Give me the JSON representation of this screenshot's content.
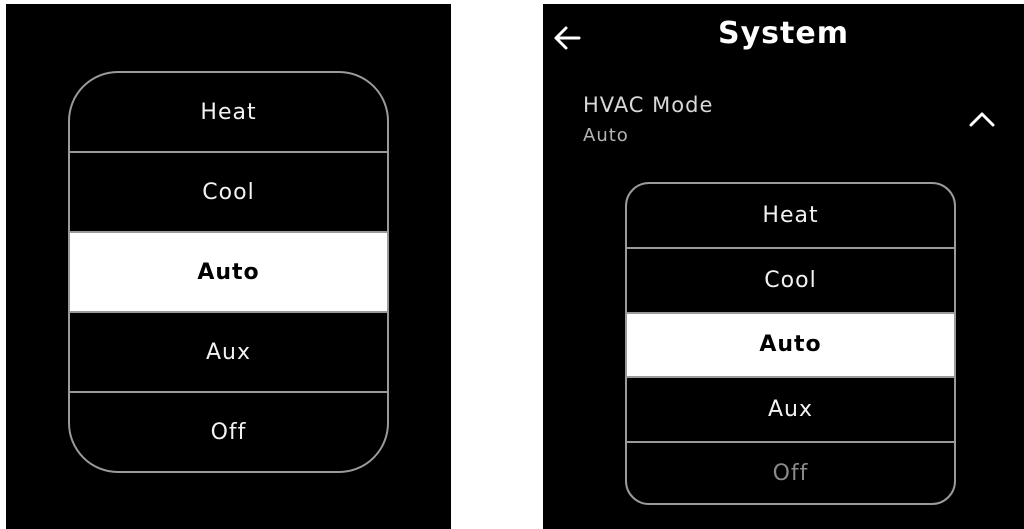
{
  "left_panel": {
    "options": [
      {
        "label": "Heat"
      },
      {
        "label": "Cool"
      },
      {
        "label": "Auto",
        "selected": true
      },
      {
        "label": "Aux"
      },
      {
        "label": "Off"
      }
    ]
  },
  "right_panel": {
    "header": {
      "title": "System",
      "back_icon": "arrow-left-icon"
    },
    "setting": {
      "label": "HVAC Mode",
      "value": "Auto",
      "toggle_icon": "chevron-up-icon"
    },
    "options": [
      {
        "label": "Heat"
      },
      {
        "label": "Cool"
      },
      {
        "label": "Auto",
        "selected": true
      },
      {
        "label": "Aux"
      },
      {
        "label": "Off",
        "dimmed": true
      }
    ]
  },
  "colors": {
    "background": "#000000",
    "text": "#f2f2f2",
    "selected_bg": "#ffffff",
    "selected_text": "#000000",
    "border": "#9a9a9a"
  }
}
